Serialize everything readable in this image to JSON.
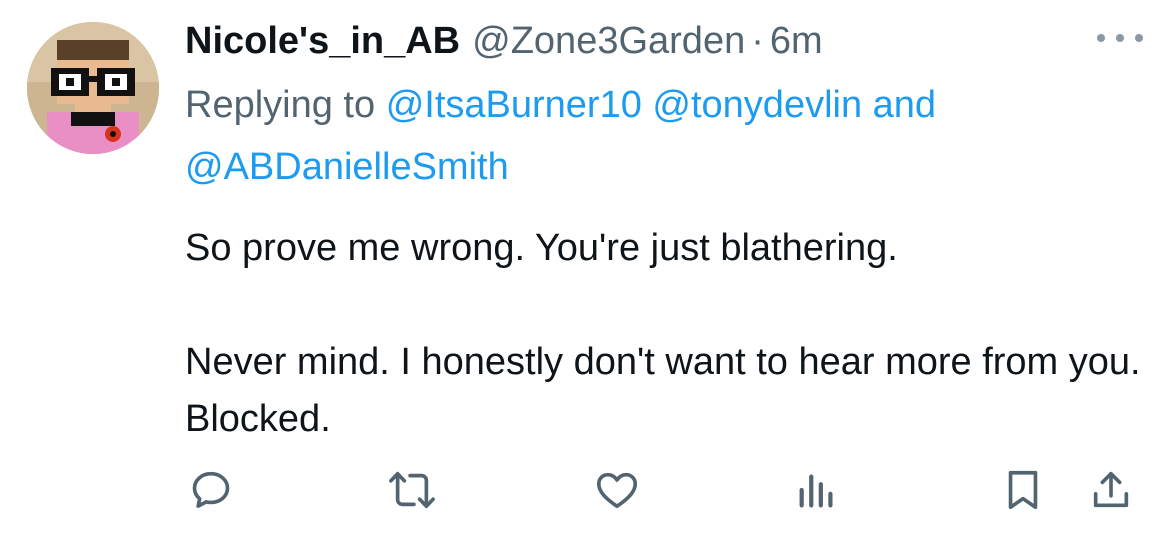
{
  "tweet": {
    "display_name": "Nicole's_in_AB",
    "handle": "@Zone3Garden",
    "separator": "·",
    "time": "6m",
    "replying_prefix": "Replying to",
    "mentions": [
      "@ItsaBurner10",
      "@tonydevlin",
      "@ABDanielleSmith"
    ],
    "mention_joiner": "and",
    "paragraphs": [
      "So prove me wrong. You're just blathering.",
      "Never mind. I honestly don't want to hear more from you. Blocked."
    ]
  },
  "icons": {
    "more": "more-icon",
    "reply": "reply-icon",
    "retweet": "retweet-icon",
    "like": "like-icon",
    "views": "views-icon",
    "bookmark": "bookmark-icon",
    "share": "share-icon"
  },
  "colors": {
    "text": "#0f1419",
    "secondary": "#536471",
    "link": "#1d9bf0",
    "icon": "#536471"
  }
}
